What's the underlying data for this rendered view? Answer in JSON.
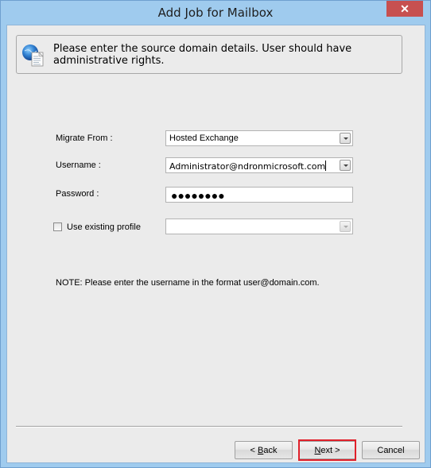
{
  "window": {
    "title": "Add Job for Mailbox",
    "close_icon": "close-icon"
  },
  "info": {
    "icon": "globe-document-icon",
    "text": "Please enter the source domain details. User should have administrative rights."
  },
  "form": {
    "migrate_from": {
      "label": "Migrate From :",
      "value": "Hosted Exchange"
    },
    "username": {
      "label": "Username :",
      "value": "Administrator@ndronmicrosoft.com"
    },
    "password": {
      "label": "Password :",
      "masked_value": "●●●●●●●●"
    },
    "use_existing_profile": {
      "label": "Use existing profile",
      "checked": false,
      "value": ""
    }
  },
  "note": "NOTE: Please enter the username in the format user@domain.com.",
  "buttons": {
    "back": {
      "prefix": "< ",
      "mnemonic": "B",
      "rest": "ack"
    },
    "next": {
      "mnemonic": "N",
      "rest": "ext >"
    },
    "cancel": "Cancel"
  },
  "colors": {
    "frame": "#9fcbee",
    "close": "#c75050",
    "client": "#ebebeb",
    "highlight": "#e0202a"
  }
}
